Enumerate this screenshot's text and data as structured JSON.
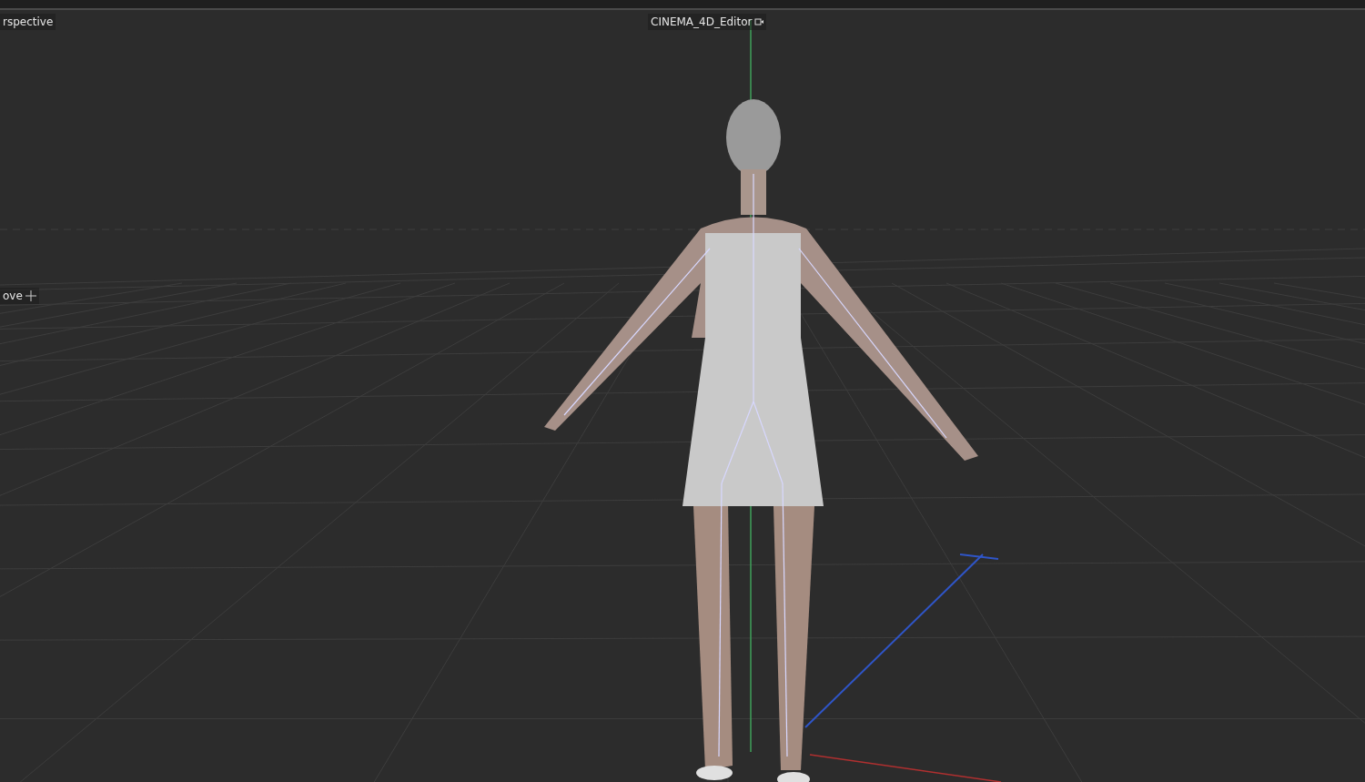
{
  "viewport": {
    "view_name": "rspective",
    "camera_name": "CINEMA_4D_Editor",
    "tool_name": "ove"
  }
}
